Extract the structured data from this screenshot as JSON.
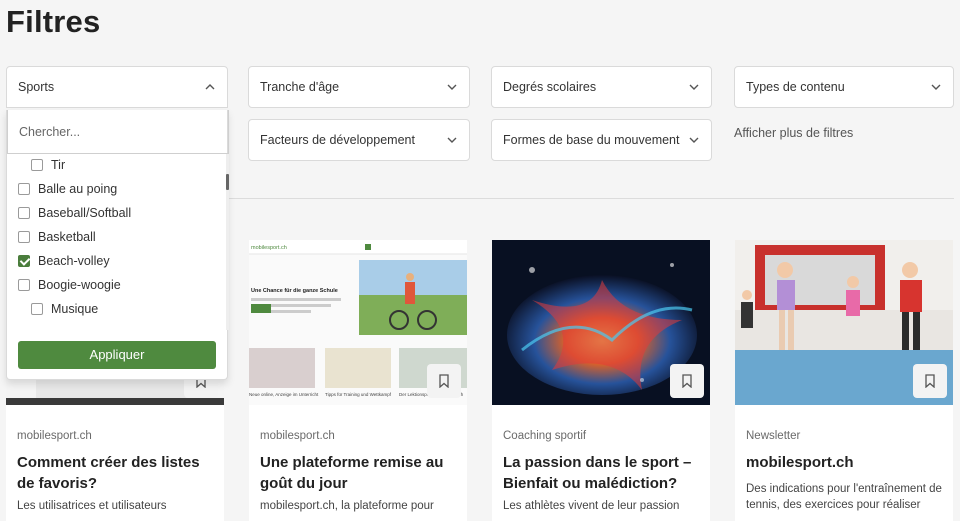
{
  "page": {
    "title": "Filtres"
  },
  "filters": {
    "sports": "Sports",
    "tranche_age": "Tranche d'âge",
    "degres_scolaires": "Degrés scolaires",
    "types_contenu": "Types de contenu",
    "facteurs_developpement": "Facteurs de développement",
    "formes_mouvement": "Formes de base du mouvement",
    "more_filters": "Afficher plus de filtres"
  },
  "dropdown": {
    "search_placeholder": "Chercher...",
    "options": [
      {
        "label": "Tir",
        "checked": false,
        "sub": true
      },
      {
        "label": "Balle au poing",
        "checked": false,
        "sub": false
      },
      {
        "label": "Baseball/Softball",
        "checked": false,
        "sub": false
      },
      {
        "label": "Basketball",
        "checked": false,
        "sub": false
      },
      {
        "label": "Beach-volley",
        "checked": true,
        "sub": false
      },
      {
        "label": "Boogie-woogie",
        "checked": false,
        "sub": false
      },
      {
        "label": "Musique",
        "checked": false,
        "sub": true
      }
    ],
    "apply_label": "Appliquer"
  },
  "cards": [
    {
      "category": "mobilesport.ch",
      "title": "Comment créer des listes de favoris?",
      "description": "Les utilisatrices et utilisateurs"
    },
    {
      "category": "mobilesport.ch",
      "title": "Une plateforme remise au goût du jour",
      "description": "mobilesport.ch, la plateforme pour",
      "thumb": {
        "logo": "mobilesport.ch",
        "headline": "Une Chance für die ganze Schule",
        "caption_1": "Neue online, Anzeige im Unterricht",
        "caption_2": "Tipps für Training und Wettkampf",
        "caption_3": "Der Lektionsplan mobilesport.ch"
      }
    },
    {
      "category": "Coaching sportif",
      "title": "La passion dans le sport – Bienfait ou malédiction?",
      "description": "Les athlètes vivent de leur passion"
    },
    {
      "category": "Newsletter",
      "title": "mobilesport.ch",
      "description": "Des indications pour l'entraînement de tennis, des exercices pour réaliser"
    }
  ],
  "colors": {
    "accent": "#4f8a3f",
    "background": "#f5f5f5"
  }
}
